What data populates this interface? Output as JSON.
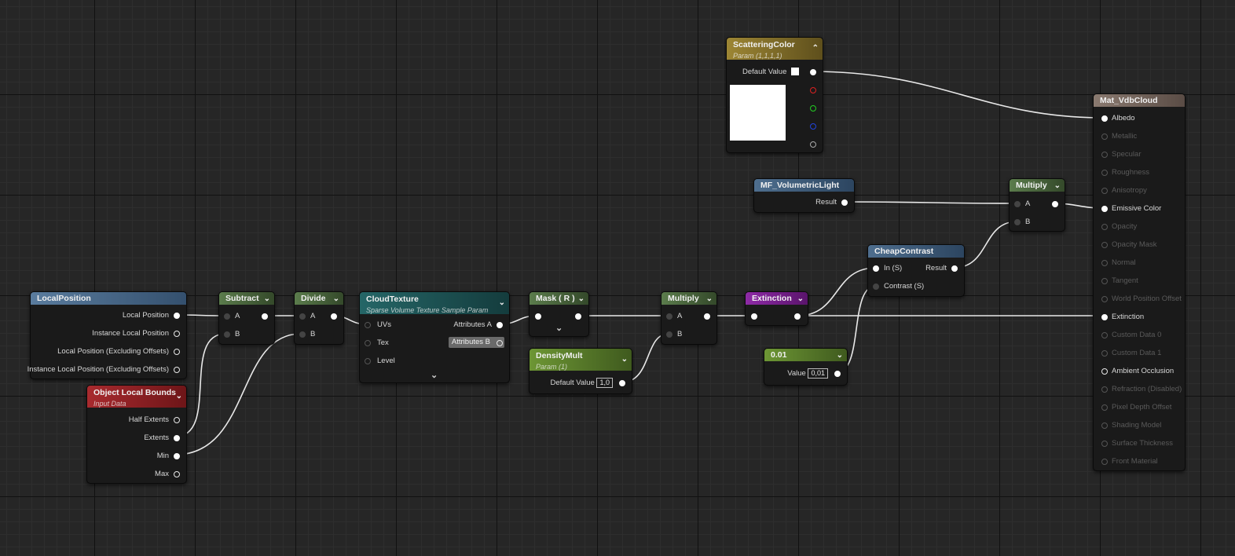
{
  "nodes": {
    "local_position": {
      "title": "LocalPosition",
      "outputs": [
        "Local Position",
        "Instance Local Position",
        "Local Position (Excluding Offsets)",
        "Instance Local Position (Excluding Offsets)"
      ]
    },
    "object_local_bounds": {
      "title": "Object Local Bounds",
      "subtitle": "Input Data",
      "outputs": [
        "Half Extents",
        "Extents",
        "Min",
        "Max"
      ]
    },
    "subtract": {
      "title": "Subtract",
      "inputs": [
        "A",
        "B"
      ]
    },
    "divide": {
      "title": "Divide",
      "inputs": [
        "A",
        "B"
      ]
    },
    "cloud_texture": {
      "title": "CloudTexture",
      "subtitle": "Sparse Volume Texture Sample Param",
      "inputs": [
        "UVs",
        "Tex",
        "Level"
      ],
      "outputs": [
        "Attributes A",
        "Attributes B"
      ]
    },
    "mask": {
      "title": "Mask ( R )"
    },
    "density_mult": {
      "title": "DensityMult",
      "subtitle": "Param (1)",
      "default_label": "Default Value",
      "default_value": "1,0"
    },
    "multiply_mid": {
      "title": "Multiply",
      "inputs": [
        "A",
        "B"
      ]
    },
    "extinction": {
      "title": "Extinction"
    },
    "constant": {
      "title": "0.01",
      "value_label": "Value",
      "value": "0,01"
    },
    "cheap_contrast": {
      "title": "CheapContrast",
      "inputs": [
        "In (S)",
        "Contrast (S)"
      ],
      "output": "Result"
    },
    "mf_volumetric_light": {
      "title": "MF_VolumetricLight",
      "output": "Result"
    },
    "multiply_top": {
      "title": "Multiply",
      "inputs": [
        "A",
        "B"
      ]
    },
    "scattering_color": {
      "title": "ScatteringColor",
      "subtitle": "Param (1,1,1,1)",
      "default_label": "Default Value"
    },
    "material": {
      "title": "Mat_VdbCloud",
      "pins": [
        "Albedo",
        "Metallic",
        "Specular",
        "Roughness",
        "Anisotropy",
        "Emissive Color",
        "Opacity",
        "Opacity Mask",
        "Normal",
        "Tangent",
        "World Position Offset",
        "Extinction",
        "Custom Data 0",
        "Custom Data 1",
        "Ambient Occlusion",
        "Refraction (Disabled)",
        "Pixel Depth Offset",
        "Shading Model",
        "Surface Thickness",
        "Front Material"
      ],
      "active_pins": [
        "Albedo",
        "Emissive Color",
        "Extinction",
        "Ambient Occlusion"
      ]
    }
  },
  "colors": {
    "header_blue": "#3f5f7f",
    "header_red": "#8a1e22",
    "header_green": "#3f5a34",
    "header_teal": "#1f5152",
    "header_lime": "#587a2c",
    "header_purple": "#6e1e82",
    "header_gold": "#7d6a2a",
    "header_brown": "#6a5a52",
    "wire": "#e8e8e8"
  }
}
